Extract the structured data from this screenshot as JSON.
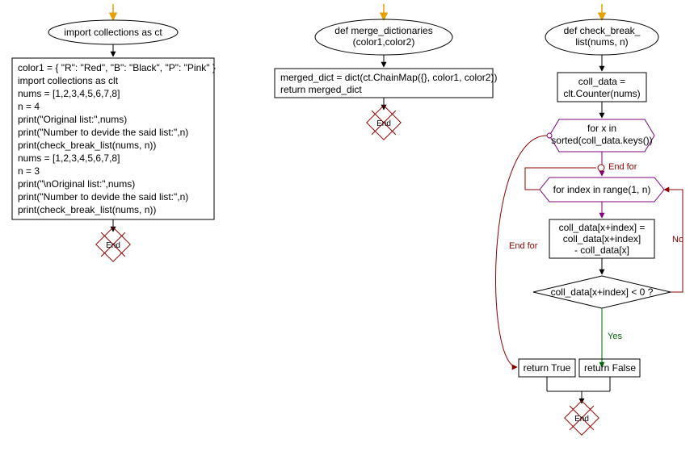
{
  "col1": {
    "ellipse": "import collections as ct",
    "body": {
      "l1": "color1 = { \"R\": \"Red\", \"B\": \"Black\", \"P\": \"Pink\" }",
      "l2": "import collections as clt",
      "l3": "nums = [1,2,3,4,5,6,7,8]",
      "l4": "n = 4",
      "l5": "print(\"Original list:\",nums)",
      "l6": "print(\"Number to devide the said list:\",n)",
      "l7": "print(check_break_list(nums, n))",
      "l8": "nums = [1,2,3,4,5,6,7,8]",
      "l9": "n = 3",
      "l10": "print(\"\\nOriginal list:\",nums)",
      "l11": "print(\"Number to devide the said list:\",n)",
      "l12": "print(check_break_list(nums, n))"
    },
    "end": "End"
  },
  "col2": {
    "ellipse": {
      "l1": "def merge_dictionaries",
      "l2": "(color1,color2)"
    },
    "body": {
      "l1": "merged_dict = dict(ct.ChainMap({}, color1, color2))",
      "l2": "return merged_dict"
    },
    "end": "End"
  },
  "col3": {
    "ellipse": {
      "l1": "def check_break_",
      "l2": "list(nums, n)"
    },
    "counter": {
      "l1": "coll_data =",
      "l2": "clt.Counter(nums)"
    },
    "outerLoop": {
      "l1": "for x in",
      "l2": "sorted(coll_data.keys())"
    },
    "outerEnd": "End for",
    "innerLoop": "for index in range(1, n)",
    "innerEnd": "End for",
    "assign": {
      "l1": "coll_data[x+index] =",
      "l2": "coll_data[x+index]",
      "l3": "- coll_data[x]"
    },
    "cond": "coll_data[x+index] < 0 ?",
    "yes": "Yes",
    "no": "No",
    "retTrue": "return True",
    "retFalse": "return False",
    "end": "End"
  }
}
